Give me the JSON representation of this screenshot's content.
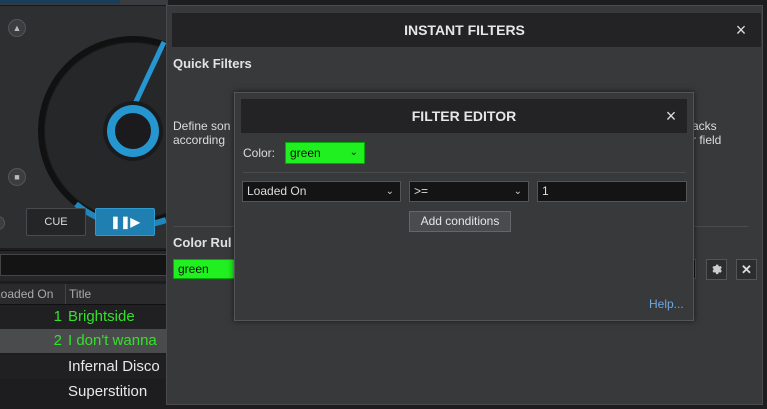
{
  "deck": {
    "cue_label": "CUE",
    "play_pause_label": "❚❚▶"
  },
  "browser": {
    "columns": [
      "Loaded On ▾",
      "Title"
    ],
    "rows": [
      {
        "num": "1",
        "title": "Brightside"
      },
      {
        "num": "2",
        "title": "I don't wanna"
      },
      {
        "num": "",
        "title": "Infernal Disco"
      },
      {
        "num": "",
        "title": "Superstition"
      }
    ]
  },
  "instant_filters": {
    "title": "INSTANT FILTERS",
    "close_glyph": "×",
    "quick_filters_label": "Quick Filters",
    "define_text_lines": [
      "Define son",
      "according"
    ],
    "right_text_lines": [
      "acks",
      "r field"
    ],
    "color_rules_label": "Color Rul",
    "rule_name": "green",
    "rule_remove_glyph": "✕"
  },
  "filter_editor": {
    "title": "FILTER EDITOR",
    "close_glyph": "×",
    "color_label": "Color:",
    "color_value": "green",
    "condition": {
      "field": "Loaded On",
      "operator": ">=",
      "value": "1"
    },
    "add_conditions_label": "Add conditions",
    "help_label": "Help..."
  },
  "colors": {
    "accent_blue": "#1e7fb0",
    "rule_green": "#20f020",
    "track_green": "#35e02a",
    "link_blue": "#6fa7e0"
  }
}
